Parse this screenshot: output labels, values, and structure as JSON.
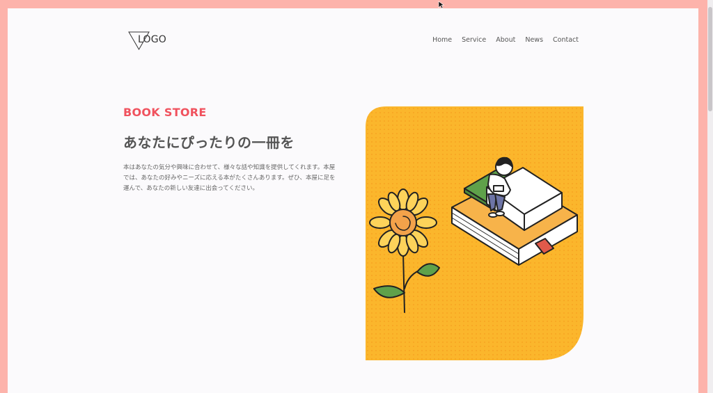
{
  "header": {
    "logo_text": "LOGO",
    "nav": [
      "Home",
      "Service",
      "About",
      "News",
      "Contact"
    ]
  },
  "hero": {
    "eyebrow": "BOOK STORE",
    "headline": "あなたにぴったりの一冊を",
    "description": "本はあなたの気分や興味に合わせて、様々な話や知識を提供してくれます。本屋では、あなたの好みやニーズに応える本がたくさんあります。ぜひ、本屋に足を運んで、あなたの新しい友達に出会ってください。"
  },
  "colors": {
    "frame": "#fdb3ab",
    "page_bg": "#fbfafc",
    "accent": "#f0525e",
    "illustration_bg": "#fbb62c",
    "text": "#555555"
  },
  "icons": [
    "logo-triangle-icon",
    "cursor-icon"
  ],
  "illustration": "person reading on stacked books beside a sunflower"
}
